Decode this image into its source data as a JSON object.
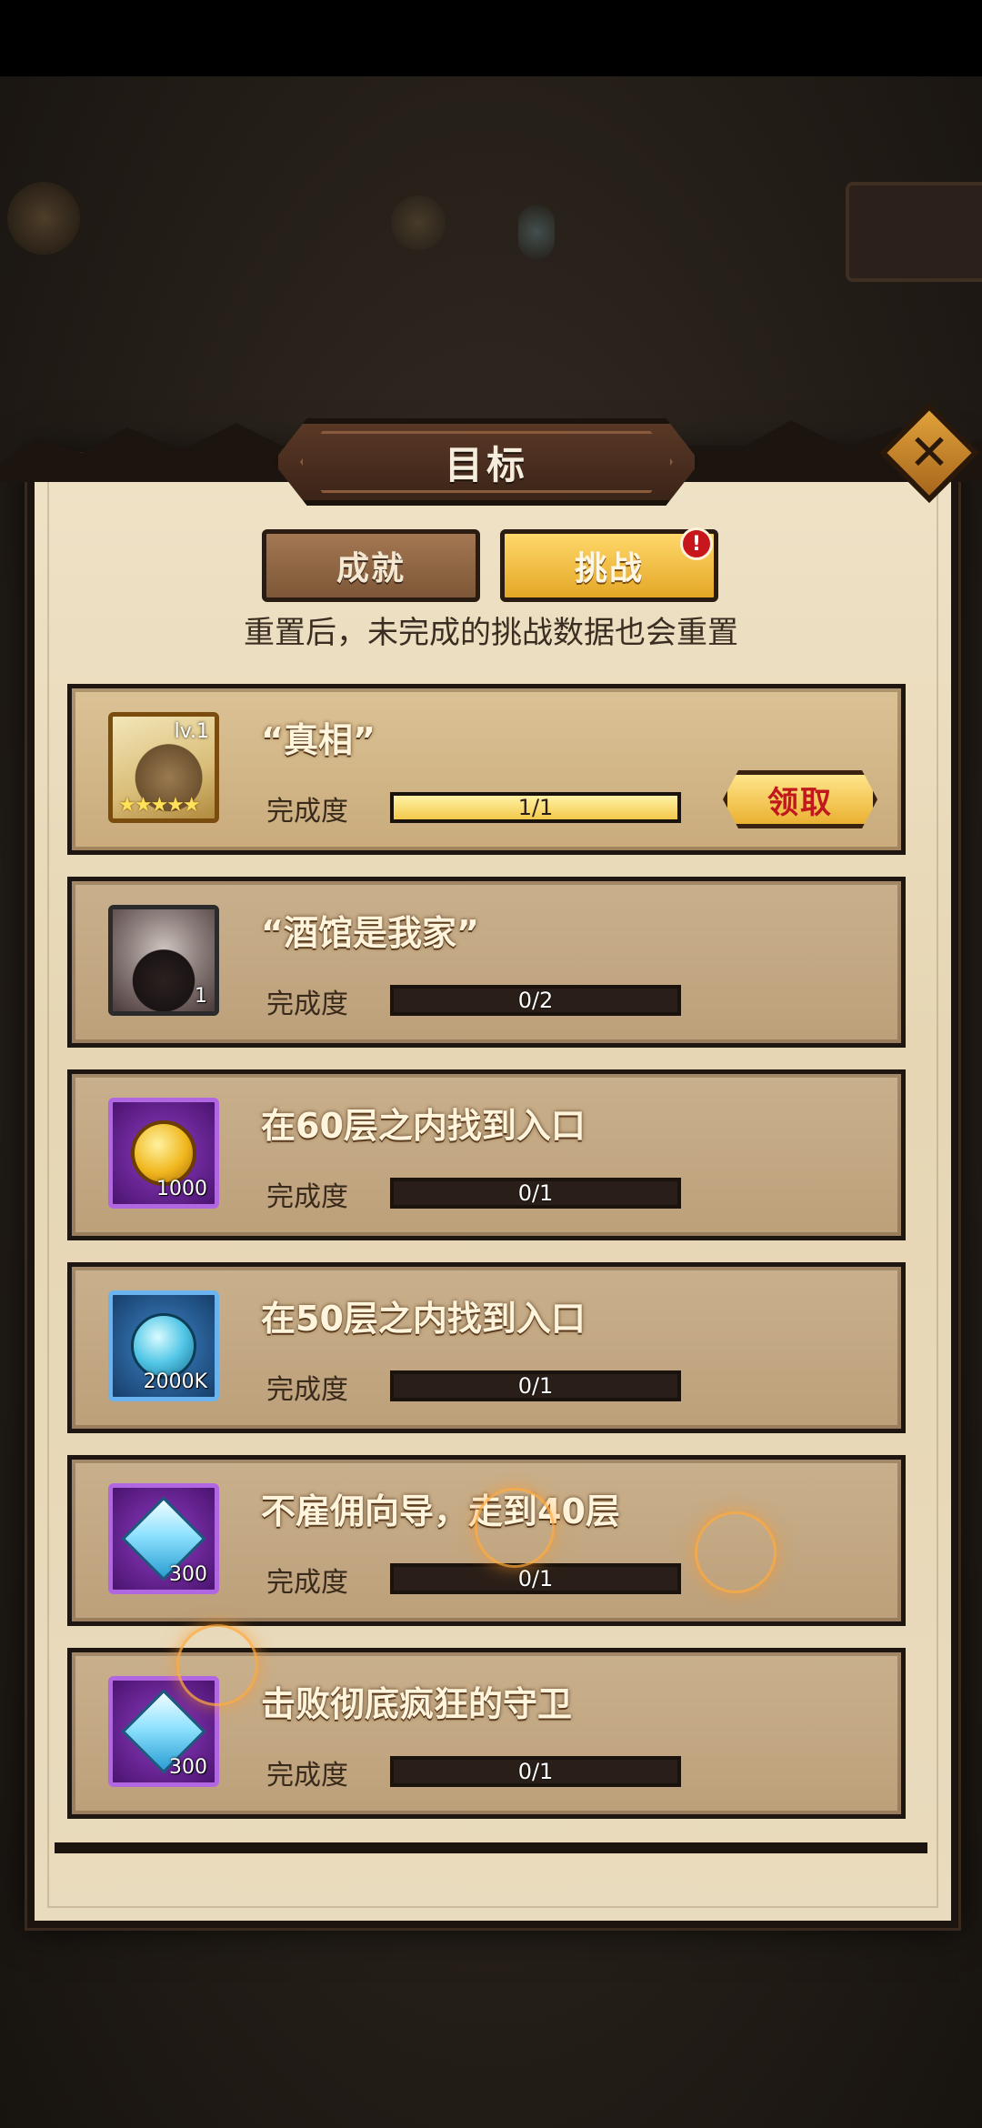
{
  "dialog": {
    "title": "目标",
    "tabs": [
      {
        "label": "成就",
        "active": false
      },
      {
        "label": "挑战",
        "active": true,
        "badge": "!"
      }
    ],
    "notice": "重置后，未完成的挑战数据也会重置"
  },
  "tasks": [
    {
      "title": "“真相”",
      "progress_label": "完成度",
      "progress_text": "1/1",
      "progress_fraction": 1.0,
      "icon": "hero-portrait-icon",
      "icon_level": "lv.1",
      "icon_stars": "★★★★★",
      "claim_label": "领取"
    },
    {
      "title": "“酒馆是我家”",
      "progress_label": "完成度",
      "progress_text": "0/2",
      "progress_fraction": 0.0,
      "icon": "dark-hero-portrait-icon",
      "icon_qty": "1"
    },
    {
      "title": "在60层之内找到入口",
      "progress_label": "完成度",
      "progress_text": "0/1",
      "progress_fraction": 0.0,
      "icon": "gold-coin-icon",
      "icon_qty": "1000"
    },
    {
      "title": "在50层之内找到入口",
      "progress_label": "完成度",
      "progress_text": "0/1",
      "progress_fraction": 0.0,
      "icon": "soul-orb-icon",
      "icon_qty": "2000K"
    },
    {
      "title": "不雇佣向导，走到40层",
      "progress_label": "完成度",
      "progress_text": "0/1",
      "progress_fraction": 0.0,
      "icon": "diamond-icon",
      "icon_qty": "300"
    },
    {
      "title": "击败彻底疯狂的守卫",
      "progress_label": "完成度",
      "progress_text": "0/1",
      "progress_fraction": 0.0,
      "icon": "diamond-icon",
      "icon_qty": "300"
    }
  ],
  "close_icon": "close-icon",
  "colors": {
    "panel": "#e6d6b4",
    "card": "#bca07a",
    "accent_gold": "#f3c94a",
    "claim_text": "#c0181c"
  }
}
